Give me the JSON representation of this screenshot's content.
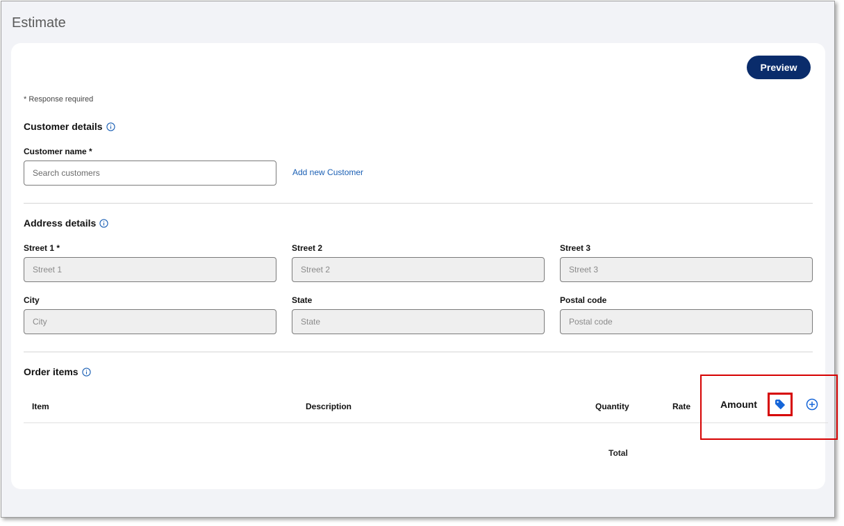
{
  "page": {
    "title": "Estimate"
  },
  "toolbar": {
    "preview_label": "Preview"
  },
  "form": {
    "required_note": "* Response required"
  },
  "customer_details": {
    "title": "Customer details",
    "customer_name_label": "Customer name *",
    "search_placeholder": "Search customers",
    "add_new_link": "Add new Customer"
  },
  "address_details": {
    "title": "Address details",
    "street1_label": "Street 1 *",
    "street1_placeholder": "Street 1",
    "street2_label": "Street 2",
    "street2_placeholder": "Street 2",
    "street3_label": "Street 3",
    "street3_placeholder": "Street 3",
    "city_label": "City",
    "city_placeholder": "City",
    "state_label": "State",
    "state_placeholder": "State",
    "postal_label": "Postal code",
    "postal_placeholder": "Postal code"
  },
  "order_items": {
    "title": "Order items",
    "columns": {
      "item": "Item",
      "description": "Description",
      "quantity": "Quantity",
      "rate": "Rate",
      "amount": "Amount"
    },
    "total_label": "Total"
  },
  "icons": {
    "info": "info-icon",
    "tag": "tag-icon",
    "add": "add-circle-icon"
  },
  "colors": {
    "primary": "#0a2c6b",
    "link": "#1a5fb4",
    "tag_icon": "#1565d8",
    "highlight": "#d60000"
  }
}
